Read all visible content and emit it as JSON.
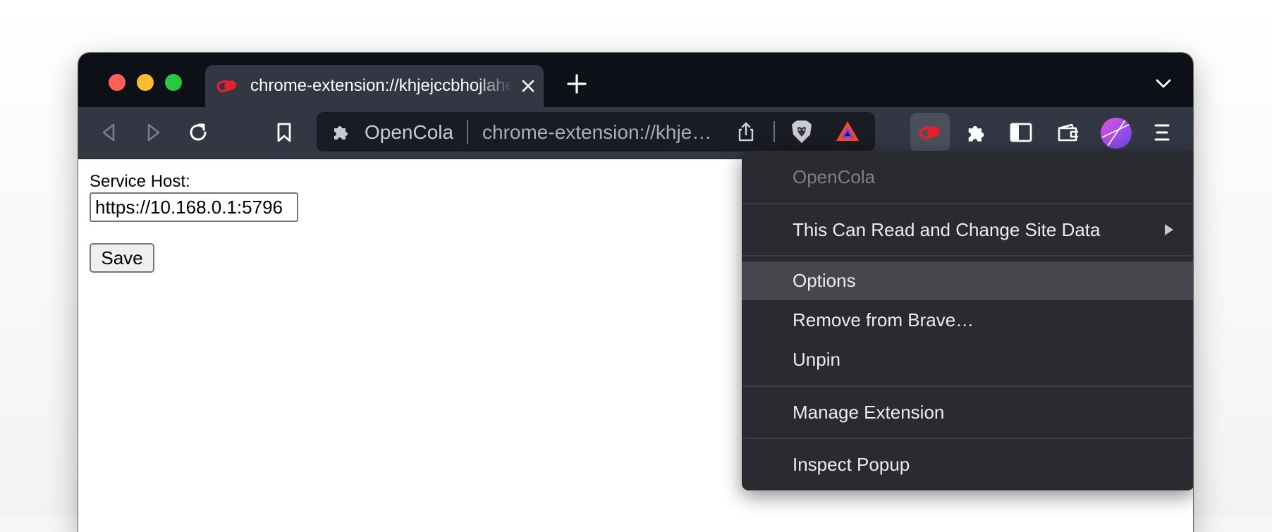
{
  "tab": {
    "title": "chrome-extension://khjejccbhojlaheolnechhabpleamhkd/options.html",
    "favicon": "opencola-icon"
  },
  "toolbar": {
    "extension_name": "OpenCola",
    "url": "chrome-extension://khjejccbhojlaheolnechhabpleamhkd/options.html"
  },
  "page": {
    "service_host_label": "Service Host:",
    "service_host_value": "https://10.168.0.1:5796",
    "save_label": "Save"
  },
  "context_menu": {
    "header": "OpenCola",
    "site_access": "This Can Read and Change Site Data",
    "options": "Options",
    "remove": "Remove from Brave…",
    "unpin": "Unpin",
    "manage": "Manage Extension",
    "inspect": "Inspect Popup"
  },
  "colors": {
    "tab_strip": "#0e1017",
    "toolbar": "#333744",
    "omnibox": "#1a1c23",
    "menu": "#2a2b30",
    "menu_hover": "#46474d",
    "opencola_red": "#e5202e"
  }
}
